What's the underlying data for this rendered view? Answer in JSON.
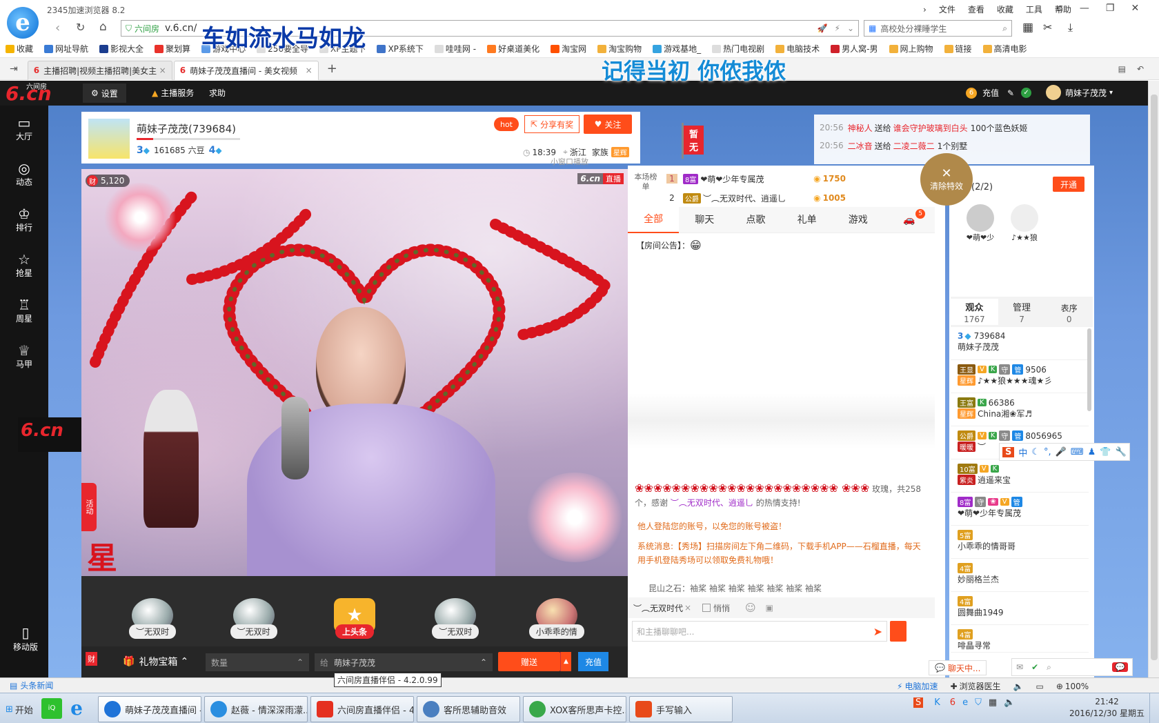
{
  "browser": {
    "title": "2345加速浏览器 8.2",
    "menu": [
      "文件",
      "查看",
      "收藏",
      "工具",
      "帮助"
    ],
    "address_security": "六间房",
    "address_url": "v.6.cn/",
    "search_placeholder": "高校处分裸睡学生",
    "overlay_line1": "车如流水马如龙",
    "overlay_line2": "记得当初 你侬我侬",
    "bookmarks": [
      "收藏",
      "网址导航",
      "影视大全",
      "聚划算",
      "游戏中心",
      "256要全导",
      "XP主题下",
      "XP系统下",
      "哇哇网 -",
      "好桌道美化",
      "淘宝网",
      "淘宝购物",
      "游戏基地_",
      "热门电视剧",
      "电脑技术",
      "男人窝-男",
      "网上购物",
      "链接",
      "高清电影"
    ],
    "tabs": [
      {
        "label": "主播招聘|视频主播招聘|美女主"
      },
      {
        "label": "萌妹子茂茂直播间 - 美女视频"
      }
    ]
  },
  "site": {
    "logo": "6.cn",
    "logo_sub": "六间房",
    "topnav": {
      "settings": "设置",
      "anchor_service": "主播服务",
      "help": "求助",
      "recharge": "充值",
      "user": "萌妹子茂茂"
    },
    "sidenav": [
      {
        "label": "大厅",
        "sub": "动态",
        "icon": "tv-icon"
      },
      {
        "label": "动态",
        "sub": "排行",
        "icon": "compass-icon"
      },
      {
        "label": "排行",
        "sub": "抢星",
        "icon": "crown-icon"
      },
      {
        "label": "抢星",
        "sub": "周星",
        "icon": "star-icon"
      },
      {
        "label": "周星",
        "sub": "马甲",
        "icon": "trophy-icon"
      },
      {
        "label": "马甲",
        "sub": "",
        "icon": "shirt-icon"
      }
    ],
    "mobile_label": "移动版"
  },
  "room": {
    "anchor_name": "萌妹子茂茂(739684)",
    "level_left": "3",
    "beans": "161685 六豆",
    "level_right": "4",
    "hot_label": "hot",
    "share_label": "分享有奖",
    "follow_label": "关注",
    "time": "18:39",
    "location": "浙江",
    "family": "家族",
    "family_badge": "星辉",
    "small_window": "小窗口播放",
    "flag_label": "暂无",
    "wealth_count": "5,120",
    "wealth_label": "财",
    "live_logo": "6.cn",
    "live_badge": "直播",
    "activity_label": "活动",
    "star_text": "星"
  },
  "ticker": [
    {
      "time": "20:56",
      "sender": "神秘人",
      "action": "送给",
      "receiver": "谁会守护玻璃到白头",
      "gift": "100个蓝色妖姬"
    },
    {
      "time": "20:56",
      "sender": "二冰音",
      "action": "送给",
      "receiver": "二凌二薇二",
      "gift": "1个别墅"
    }
  ],
  "ranking": {
    "label": "本场榜单",
    "rows": [
      {
        "rank": "1",
        "badge": "8富",
        "name": "❤萌❤少年专属茂",
        "score": "1750"
      },
      {
        "rank": "2",
        "badge": "公爵",
        "name": "︶︵无双时代、逍遥乚",
        "score": "1005"
      }
    ]
  },
  "clear_effects": "清除特效",
  "guard": {
    "title": "守护(2/2)",
    "open_label": "开通",
    "members": [
      "❤萌❤少",
      "♪★★狼"
    ]
  },
  "chat": {
    "tabs": [
      "全部",
      "聊天",
      "点歌",
      "礼单",
      "游戏"
    ],
    "car_badge": "5",
    "notice_label": "【房间公告】：",
    "gift_msg_prefix": "玫瑰，共258个，感谢",
    "gift_msg_user": "︶︵无双时代、逍遥乚",
    "gift_msg_suffix": "的热情支持!",
    "warn1": "他人登陆您的账号，以免您的账号被盗！",
    "sys_msg": "系统消息:【秀场】扫描房间左下角二维码，下载手机APP——石榴直播，每天用手机登陆秀场可以领取免费礼物哦！",
    "last_msg": "昆山之石：袖桨 袖桨 袖桨 袖桨 袖桨 袖桨 袖桨",
    "target_user": "︶︵无双时代",
    "private_label": "悄悄",
    "input_placeholder": "和主播聊聊吧...",
    "chat_btn": "聊天中..."
  },
  "audience": {
    "tabs": [
      {
        "label": "观众",
        "count": "1767"
      },
      {
        "label": "管理",
        "count": "7"
      },
      {
        "label": "表序",
        "count": "0"
      }
    ],
    "rows": [
      {
        "id": "739684",
        "name": "萌妹子茂茂",
        "badges": [
          "3"
        ]
      },
      {
        "id": "9506",
        "name": "♪★★狼★★★魂★彡",
        "badges": [
          "王显",
          "V",
          "K",
          "守",
          "管",
          "星辉"
        ]
      },
      {
        "id": "66386",
        "name": "China湘❀军♬",
        "badges": [
          "王富",
          "K",
          "星辉"
        ]
      },
      {
        "id": "8056965",
        "name": "︶",
        "badges": [
          "公爵",
          "V",
          "K",
          "守",
          "管",
          "暖暖"
        ]
      },
      {
        "id": "",
        "name": "逍遥来宝",
        "badges": [
          "10富",
          "V",
          "K",
          "紫炎"
        ]
      },
      {
        "id": "",
        "name": "❤萌❤少年专属茂",
        "badges": [
          "8富",
          "守",
          "❀",
          "V",
          "管"
        ]
      },
      {
        "id": "",
        "name": "小乖乖的情哥哥",
        "badges": [
          "5富"
        ]
      },
      {
        "id": "",
        "name": "妙丽格兰杰",
        "badges": [
          "4富"
        ]
      },
      {
        "id": "",
        "name": "圆舞曲1949",
        "badges": [
          "4富"
        ]
      },
      {
        "id": "",
        "name": "啡晶寻常",
        "badges": [
          "4富"
        ]
      }
    ]
  },
  "gifts": {
    "items": [
      "︶无双时",
      "︶无双时",
      "上头条",
      "︶无双时",
      "小乖乖的情"
    ],
    "treasure": "礼物宝箱",
    "quantity_placeholder": "数量",
    "to_label": "给",
    "to_user": "萌妹子茂茂",
    "send_label": "赠送",
    "recharge_label": "充值"
  },
  "statusbar": {
    "news": "头条新闻",
    "tooltip": "六间房直播伴侣 - 4.2.0.99",
    "accel": "电脑加速",
    "doctor": "浏览器医生",
    "zoom": "100%"
  },
  "taskbar": {
    "start": "开始",
    "items": [
      {
        "label": "萌妹子茂茂直播间 -...",
        "color": "#1e73d8"
      },
      {
        "label": "赵薇 - 情深深雨濛...",
        "color": "#2a8ee0"
      },
      {
        "label": "六间房直播伴侣 - 4...",
        "color": "#e53020"
      },
      {
        "label": "客所思辅助音效",
        "color": "#4a7fc0"
      },
      {
        "label": "XOX客所思声卡控...",
        "color": "#39a84a"
      },
      {
        "label": "手写输入",
        "color": "#e84a1a"
      }
    ],
    "time": "21:42",
    "date": "2016/12/30 星期五"
  },
  "colors": {
    "accent": "#ff4d1a",
    "brand_blue": "#1e73d8",
    "site_dark": "#1a1a1a"
  }
}
